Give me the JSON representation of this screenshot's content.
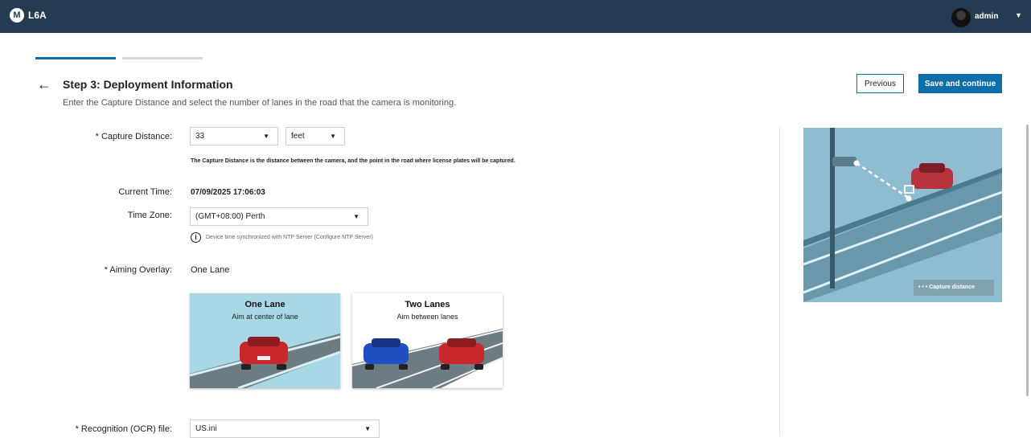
{
  "header": {
    "app_name": "L6A",
    "user_name": "admin"
  },
  "step": {
    "title": "Step 3: Deployment Information",
    "description": "Enter the Capture Distance and select the number of lanes in the road that the camera is monitoring.",
    "previous_label": "Previous",
    "save_label": "Save and continue"
  },
  "progress": {
    "completed_fraction": 0.5
  },
  "form": {
    "capture_distance": {
      "label": "* Capture Distance:",
      "value": "33",
      "unit": "feet",
      "help": "The Capture Distance is the distance between the camera, and the point in the road where license plates will be captured."
    },
    "current_time": {
      "label": "Current Time:",
      "value": "07/09/2025 17:06:03"
    },
    "time_zone": {
      "label": "Time Zone:",
      "value": "(GMT+08:00) Perth",
      "ntp_note": "Device time synchronized with NTP Server (Configure NTP Server)"
    },
    "aiming_overlay": {
      "label": "* Aiming Overlay:",
      "value": "One Lane",
      "options": [
        {
          "title": "One Lane",
          "subtitle": "Aim at center of lane",
          "selected": true
        },
        {
          "title": "Two Lanes",
          "subtitle": "Aim between lanes",
          "selected": false
        }
      ]
    },
    "ocr_file": {
      "label": "* Recognition (OCR) file:",
      "value": "US.ini"
    }
  },
  "preview": {
    "legend": "Capture distance"
  },
  "colors": {
    "topbar": "#243b52",
    "accent": "#0e6fa8",
    "selected_card": "#a8d8e6"
  }
}
